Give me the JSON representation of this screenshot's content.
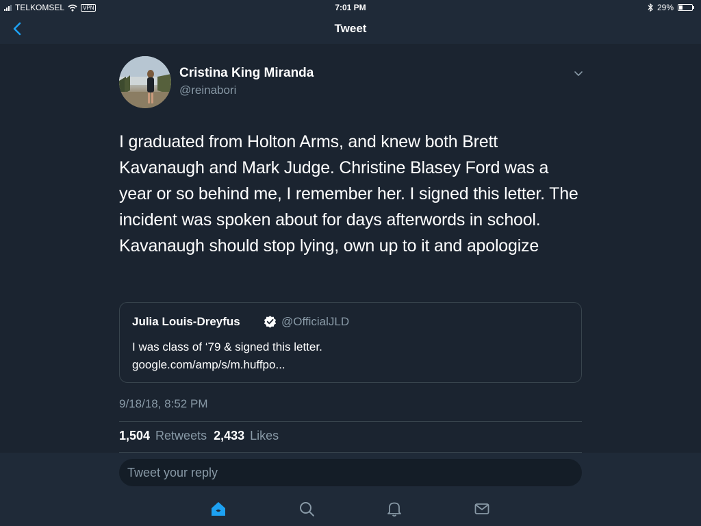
{
  "status_bar": {
    "carrier": "TELKOMSEL",
    "vpn": "VPN",
    "time": "7:01 PM",
    "battery": "29%",
    "battery_level": 0.29
  },
  "nav": {
    "title": "Tweet",
    "back_icon": "chevron-left-icon"
  },
  "tweet": {
    "author_name": "Cristina King Miranda",
    "author_handle": "@reinabori",
    "text": "I graduated from Holton Arms, and knew both Brett Kavanaugh and Mark Judge. Christine Blasey Ford was a year or so behind me, I remember her. I signed this letter. The incident was spoken about for days afterwords in school. Kavanaugh should stop lying, own up to it and apologize",
    "timestamp": "9/18/18, 8:52 PM",
    "retweets_count": "1,504",
    "retweets_label": "Retweets",
    "likes_count": "2,433",
    "likes_label": "Likes"
  },
  "quoted_tweet": {
    "author_name": "Julia Louis-Dreyfus",
    "author_handle": "@OfficialJLD",
    "verified": true,
    "text_line1": "I was class of ‘79 & signed this letter.",
    "text_line2": "google.com/amp/s/m.huffpo..."
  },
  "reply": {
    "placeholder": "Tweet your reply"
  },
  "tab_bar": {
    "items": [
      "home-icon",
      "search-icon",
      "notifications-bell-icon",
      "messages-envelope-icon"
    ],
    "active": "home-icon",
    "accent_color": "#1da1f2"
  },
  "colors": {
    "background": "#1b2430",
    "bar_background": "#1f2a38",
    "secondary_text": "#8899a6",
    "accent": "#1da1f2"
  }
}
